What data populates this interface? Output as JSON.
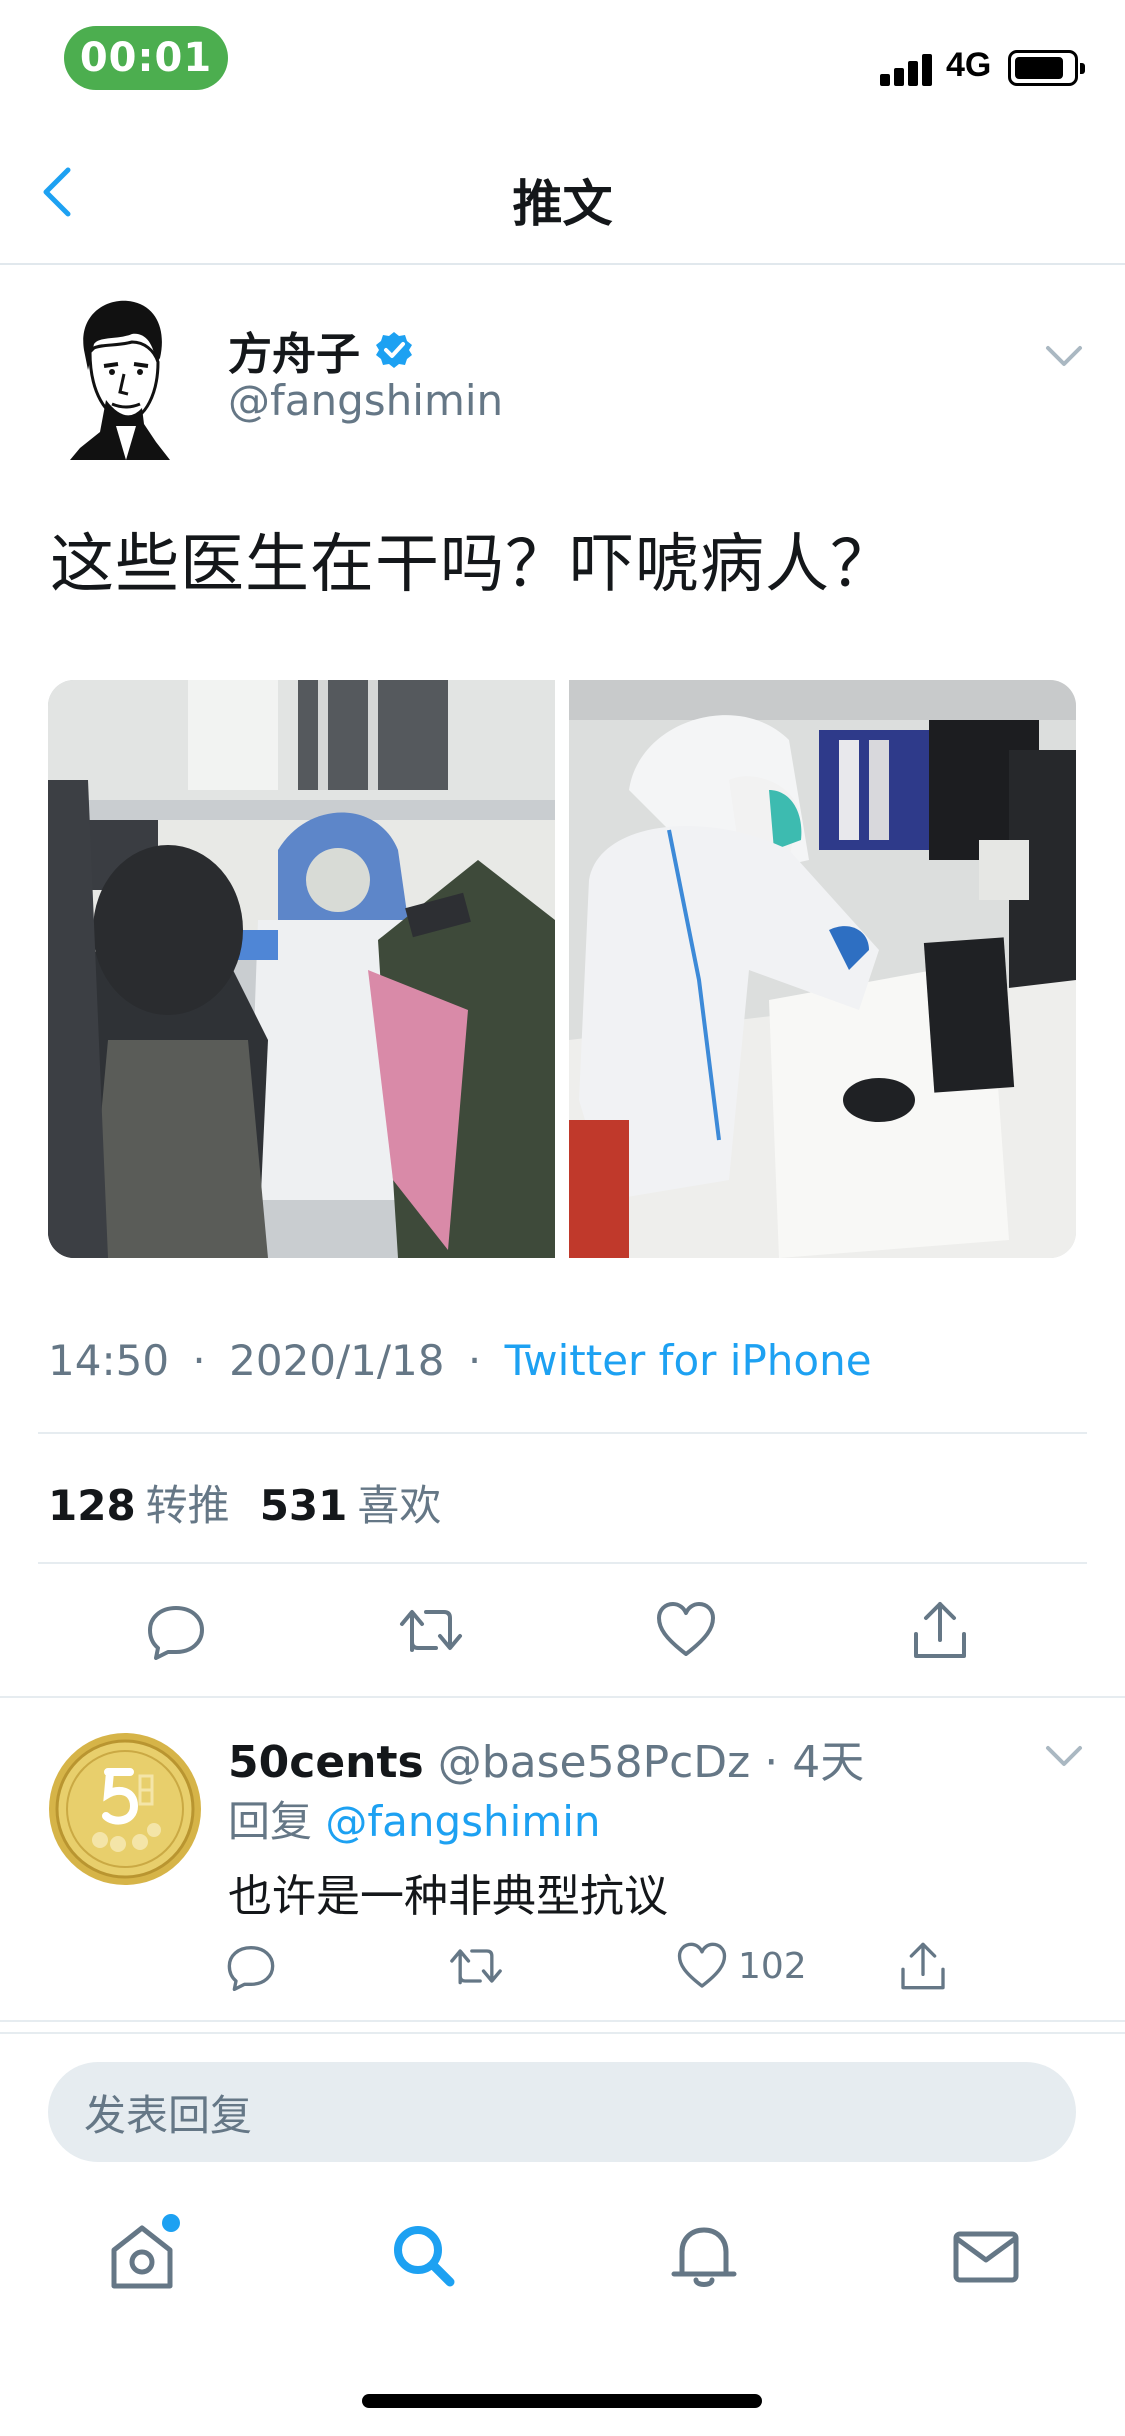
{
  "status_bar": {
    "time": "00:01",
    "network": "4G",
    "battery_percent": 85
  },
  "nav": {
    "title": "推文",
    "back_icon": "chevron-left-icon"
  },
  "tweet": {
    "display_name": "方舟子",
    "handle": "@fangshimin",
    "verified": true,
    "text": "这些医生在干吗？吓唬病人？",
    "time": "14:50",
    "date": "2020/1/18",
    "separator": "·",
    "source": "Twitter for iPhone",
    "retweet_count": "128",
    "retweet_label": "转推",
    "like_count": "531",
    "like_label": "喜欢",
    "photos": [
      "photo-1",
      "photo-2"
    ]
  },
  "reply": {
    "display_name": "50cents",
    "handle": "@base58PcDz",
    "age": "· 4天",
    "reply_prefix": "回复",
    "reply_to": "@fangshimin",
    "text": "也许是一种非典型抗议",
    "like_count": "102"
  },
  "compose": {
    "placeholder": "发表回复"
  },
  "tabs": [
    {
      "name": "home",
      "icon": "home-icon",
      "has_notification": true
    },
    {
      "name": "search",
      "icon": "search-icon",
      "active": true
    },
    {
      "name": "notifications",
      "icon": "bell-icon"
    },
    {
      "name": "messages",
      "icon": "mail-icon"
    }
  ],
  "colors": {
    "accent": "#1da1f2",
    "muted": "#657786",
    "time_pill": "#4cae4f",
    "divider": "#e6ecf0"
  }
}
